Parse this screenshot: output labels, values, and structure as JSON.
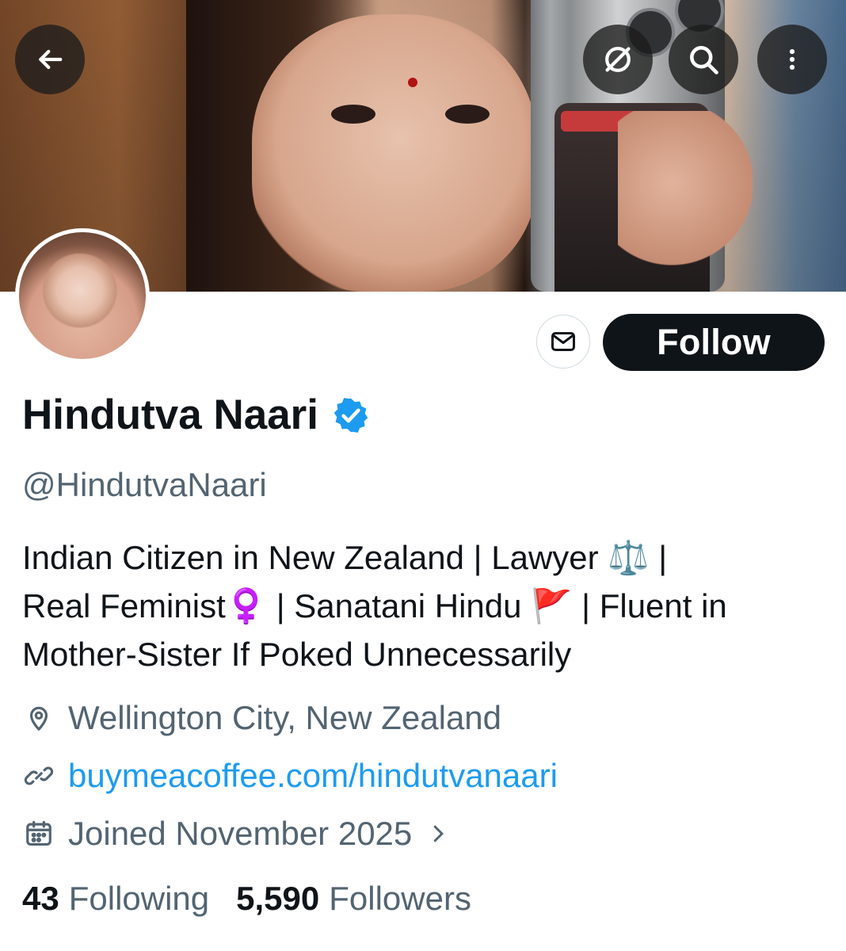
{
  "header": {
    "back_icon": "arrow-left-icon",
    "actions": [
      {
        "icon": "grok-icon"
      },
      {
        "icon": "search-icon"
      },
      {
        "icon": "more-vertical-icon"
      }
    ]
  },
  "profile": {
    "display_name": "Hindutva Naari",
    "handle": "@HindutvaNaari",
    "verified": true,
    "verified_color": "#1d9bf0",
    "bio_lines": [
      "Indian Citizen in New Zealand | Lawyer ⚖️ |",
      "Real Feminist♀️ | Sanatani Hindu 🚩 | Fluent in",
      "Mother-Sister If Poked Unnecessarily"
    ],
    "location": "Wellington City, New Zealand",
    "website": "buymeacoffee.com/hindutvanaari",
    "joined": "Joined November 2025",
    "following_count": "43",
    "following_label": "Following",
    "followers_count": "5,590",
    "followers_label": "Followers"
  },
  "actions": {
    "message_icon": "mail-icon",
    "follow_label": "Follow"
  },
  "colors": {
    "primary_text": "#0f1419",
    "secondary_text": "#536471",
    "link": "#1d9bf0",
    "button_dark": "#0f1419"
  }
}
